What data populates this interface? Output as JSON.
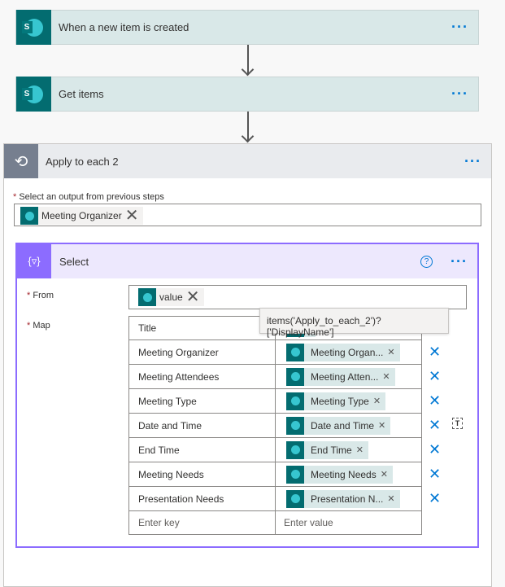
{
  "trigger": {
    "title": "When a new item is created"
  },
  "step2": {
    "title": "Get items"
  },
  "loop": {
    "title": "Apply to each 2",
    "output_label": "Select an output from previous steps",
    "output_token": "Meeting Organizer"
  },
  "select": {
    "title": "Select",
    "from_label": "From",
    "from_token": "value",
    "map_label": "Map",
    "rows": [
      {
        "key": "Title",
        "value": ""
      },
      {
        "key": "Meeting Organizer",
        "value": "Meeting Organ..."
      },
      {
        "key": "Meeting Attendees",
        "value": "Meeting Atten..."
      },
      {
        "key": "Meeting Type",
        "value": "Meeting Type"
      },
      {
        "key": "Date and Time",
        "value": "Date and Time"
      },
      {
        "key": "End Time",
        "value": "End Time"
      },
      {
        "key": "Meeting Needs",
        "value": "Meeting Needs"
      },
      {
        "key": "Presentation Needs",
        "value": "Presentation N..."
      }
    ],
    "key_placeholder": "Enter key",
    "value_placeholder": "Enter value",
    "tooltip": "items('Apply_to_each_2')?['DisplayName']"
  },
  "icons": {
    "sharepoint": "sharepoint-icon",
    "loop": "loop-icon",
    "select": "data-operation-icon",
    "help": "help-icon",
    "more": "more-icon",
    "delete": "delete-icon",
    "text-mode": "text-mode-icon"
  },
  "colors": {
    "accent": "#0078d4",
    "sharepoint": "#036c70",
    "select": "#8c6cff",
    "loop": "#767f8f"
  }
}
